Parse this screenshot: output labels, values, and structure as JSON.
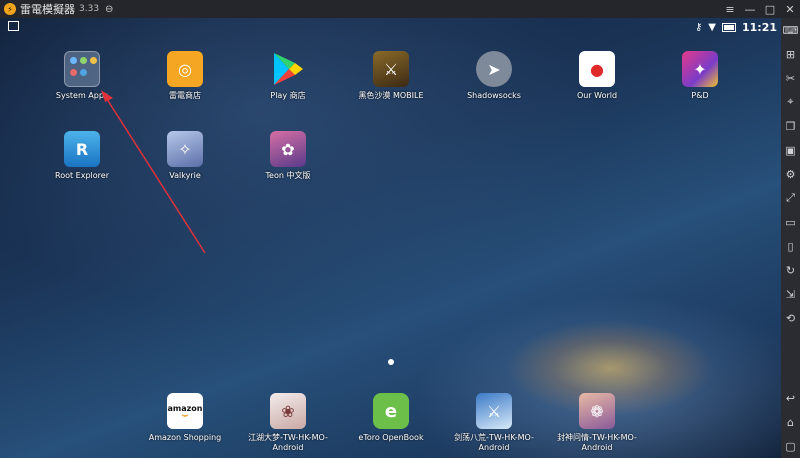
{
  "titlebar": {
    "title": "雷電模擬器",
    "version": "3.33",
    "link_icon": "link-icon",
    "controls": [
      "menu-icon",
      "minimize-icon",
      "maximize-icon",
      "close-icon"
    ]
  },
  "statusbar": {
    "left_icon": "screenshot-icon",
    "right_icons": [
      "key-icon",
      "wifi-icon",
      "battery-icon"
    ],
    "time": "11:21"
  },
  "apps": [
    {
      "name": "System Apps",
      "icon": "folder-icon"
    },
    {
      "name": "雷電商店",
      "icon": "store-icon"
    },
    {
      "name": "Play 商店",
      "icon": "play-store-icon"
    },
    {
      "name": "黑色沙漠 MOBILE",
      "icon": "game-icon"
    },
    {
      "name": "Shadowsocks",
      "icon": "paper-plane-icon"
    },
    {
      "name": "Our World",
      "icon": "map-pin-icon"
    },
    {
      "name": "P&D",
      "icon": "game-icon"
    },
    {
      "name": "Root Explorer",
      "icon": "file-explorer-icon"
    },
    {
      "name": "Valkyrie",
      "icon": "game-icon"
    },
    {
      "name": "Teon 中文版",
      "icon": "game-icon"
    }
  ],
  "dock": [
    {
      "line1": "Amazon Shopping",
      "line2": "",
      "icon": "amazon-icon",
      "icon_text": "amazon"
    },
    {
      "line1": "江湖大梦-TW-HK-MO-",
      "line2": "Android",
      "icon": "game-icon"
    },
    {
      "line1": "eToro OpenBook",
      "line2": "",
      "icon": "etoro-icon",
      "icon_text": "e"
    },
    {
      "line1": "剑荡八荒-TW-HK-MO-",
      "line2": "Android",
      "icon": "game-icon"
    },
    {
      "line1": "封神问情-TW-HK-MO-",
      "line2": "Android",
      "icon": "game-icon"
    }
  ],
  "sidebar": [
    "keyboard-icon",
    "add-apk-icon",
    "scissors-icon",
    "location-icon",
    "multi-window-icon",
    "record-icon",
    "settings-icon",
    "fullscreen-icon",
    "keymap-icon",
    "shake-icon",
    "sync-icon",
    "resize-icon",
    "rotate-icon",
    "back-icon",
    "home-icon",
    "recent-apps-icon"
  ],
  "colors": {
    "titlebar": "#24262b",
    "sidebar": "#2a2c31",
    "annotation_arrow": "#e0313a"
  }
}
